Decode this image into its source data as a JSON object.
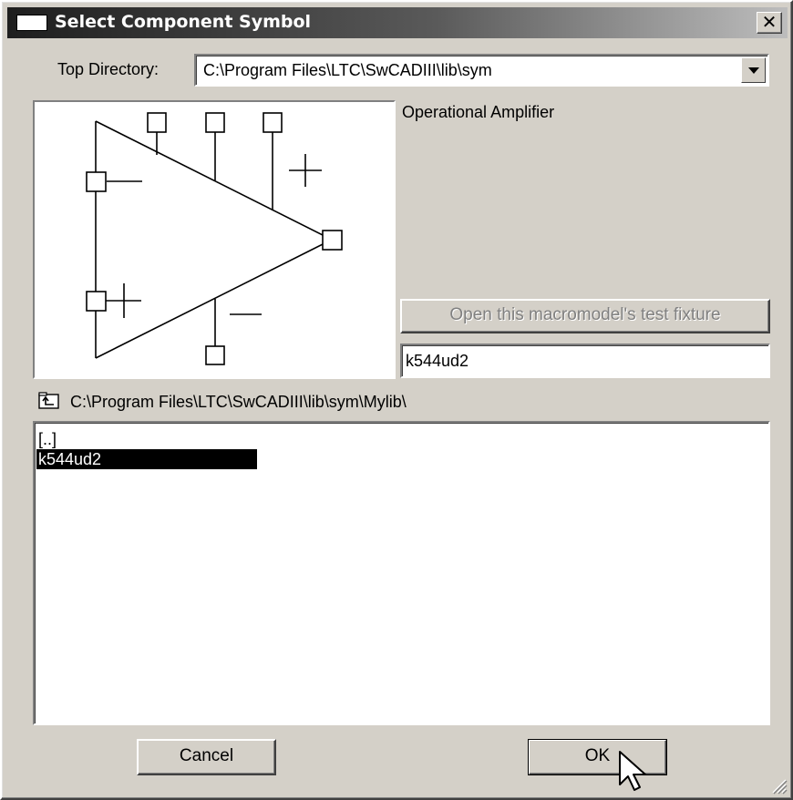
{
  "window": {
    "title": "Select Component Symbol",
    "close_glyph": "✕"
  },
  "top_directory": {
    "label": "Top Directory:",
    "value": "C:\\Program Files\\LTC\\SwCADIII\\lib\\sym"
  },
  "symbol": {
    "description": "Operational Amplifier",
    "preview_icon": "opamp-symbol-icon"
  },
  "test_fixture_button": {
    "label": "Open this macromodel's test fixture",
    "enabled": false
  },
  "symbol_name_field": {
    "value": "k544ud2"
  },
  "current_path": {
    "icon": "folder-up-icon",
    "value": "C:\\Program Files\\LTC\\SwCADIII\\lib\\sym\\Mylib\\"
  },
  "file_list": {
    "items": [
      {
        "label": "[..]",
        "selected": false
      },
      {
        "label": "k544ud2",
        "selected": true
      }
    ]
  },
  "buttons": {
    "cancel": "Cancel",
    "ok": "OK"
  },
  "colors": {
    "face": "#d4d0c8",
    "selection": "#000000",
    "title_start": "#1e1e1e",
    "title_end": "#bdbdbd"
  }
}
